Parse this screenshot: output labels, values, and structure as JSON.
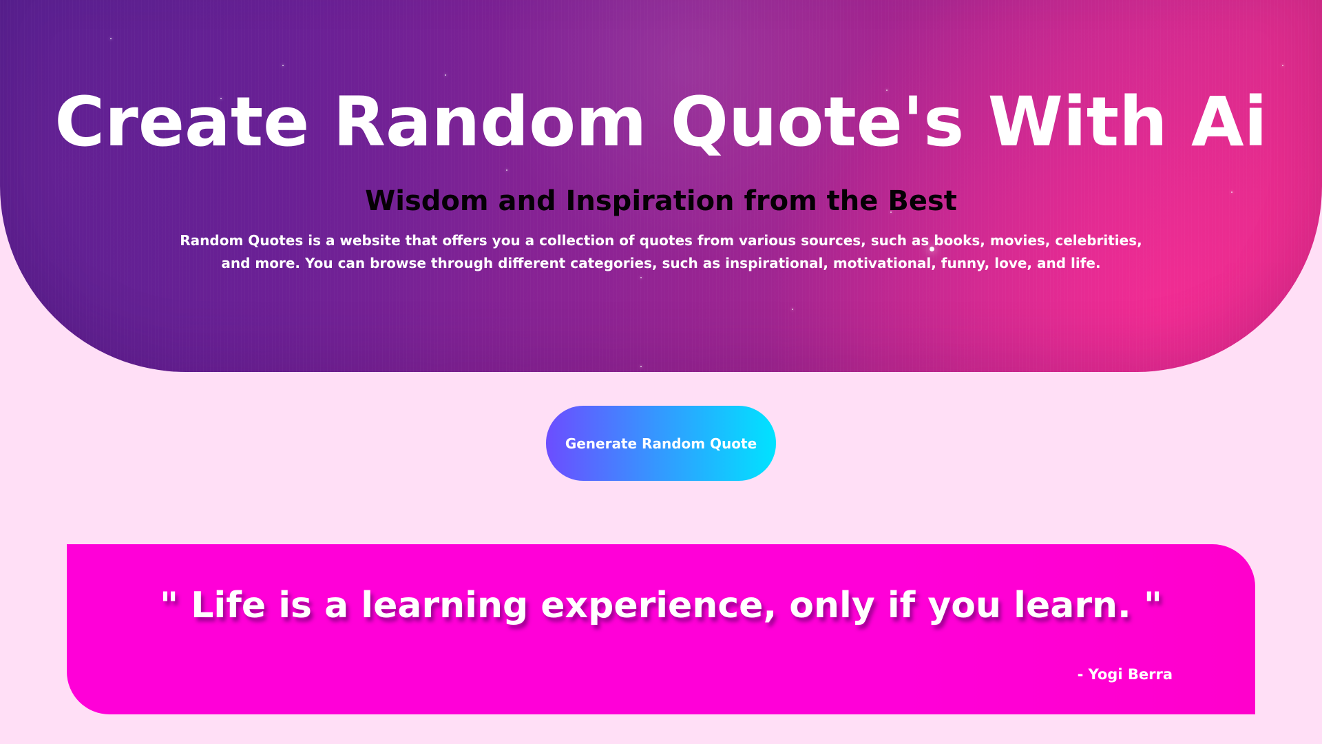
{
  "colors": {
    "page_background": "#ffdff6",
    "hero_gradient_start": "#4b1f8c",
    "hero_gradient_end": "#e02c84",
    "button_gradient_start": "#6c4dff",
    "button_gradient_end": "#00e3ff",
    "quote_card": "#ff00d8",
    "text_light": "#ffffff",
    "text_dark": "#050005"
  },
  "hero": {
    "title": "Create Random Quote's With Ai",
    "subtitle": "Wisdom and Inspiration from the Best",
    "description": "Random Quotes is a website that offers you a collection of quotes from various sources, such as books, movies, celebrities, and more. You can browse through different categories, such as inspirational, motivational, funny, love, and life.",
    "background_icon": "starry-gradient-background"
  },
  "actions": {
    "generate_button_label": "Generate Random Quote"
  },
  "quote": {
    "text": "\" Life is a learning experience, only if you learn. \"",
    "author": "- Yogi Berra"
  }
}
